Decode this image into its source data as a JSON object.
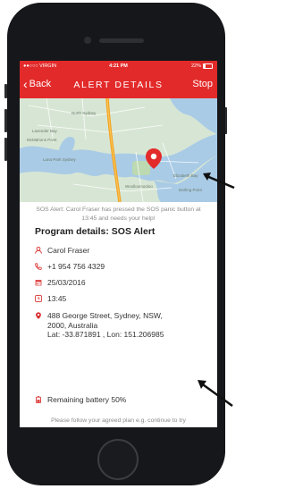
{
  "status_bar": {
    "carrier": "●●○○○ VIRGIN",
    "time": "4:21 PM",
    "battery_text": "22%",
    "battery_level": 0.22
  },
  "nav": {
    "back_label": "Back",
    "title": "ALERT DETAILS",
    "stop_label": "Stop"
  },
  "map": {
    "labels": [
      "North Sydney",
      "Lavender Bay",
      "McMahons Point",
      "Luna Park Sydney",
      "Woolloomooloo",
      "Elizabeth Bay",
      "Darling Point"
    ],
    "marker_icon": "map-pin-icon"
  },
  "alert_message": "SOS Alert: Carol Fraser has pressed the SOS panic button at 13:45 and needs your help!",
  "section_title": "Program details: SOS Alert",
  "details": {
    "name": "Carol Fraser",
    "phone": "+1 954 756 4329",
    "date": "25/03/2016",
    "time": "13:45",
    "address_lines": [
      "488 George Street, Sydney, NSW,",
      "2000, Australia",
      "Lat: -33.871891 , Lon: 151.206985"
    ],
    "battery": "Remaining battery 50%"
  },
  "footer_message": "Please follow your agreed plan e.g. continue to try",
  "colors": {
    "brand_red": "#e32a2a",
    "icon_red": "#d9302f",
    "water": "#a9cbe6",
    "land": "#d7e6d4"
  }
}
